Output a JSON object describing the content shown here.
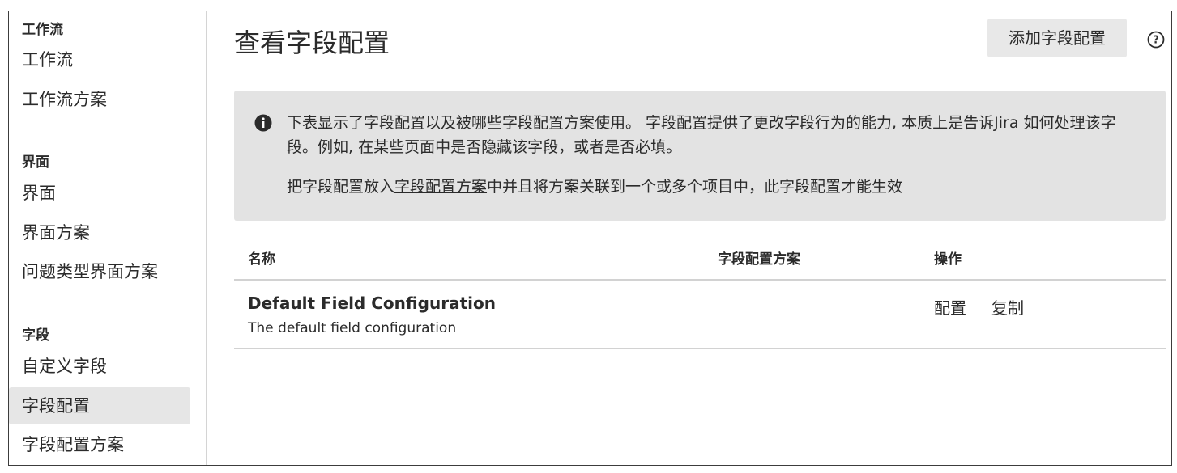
{
  "sidebar": {
    "sections": [
      {
        "heading": "工作流",
        "items": [
          "工作流",
          "工作流方案"
        ]
      },
      {
        "heading": "界面",
        "items": [
          "界面",
          "界面方案",
          "问题类型界面方案"
        ]
      },
      {
        "heading": "字段",
        "items": [
          "自定义字段",
          "字段配置",
          "字段配置方案"
        ]
      }
    ],
    "active_item": "字段配置"
  },
  "main": {
    "title": "查看字段配置",
    "add_button": "添加字段配置",
    "help_icon": "question-circle-icon",
    "info": {
      "icon": "info-circle-icon",
      "line1": "下表显示了字段配置以及被哪些字段配置方案使用。 字段配置提供了更改字段行为的能力, 本质上是告诉Jira 如何处理该字段。例如, 在某些页面中是否隐藏该字段，或者是否必填。",
      "line2_prefix": "把字段配置放入",
      "line2_link": "字段配置方案",
      "line2_suffix": "中并且将方案关联到一个或多个项目中，此字段配置才能生效"
    },
    "table": {
      "headers": [
        "名称",
        "字段配置方案",
        "操作"
      ],
      "rows": [
        {
          "name": "Default Field Configuration",
          "description": "The default field configuration",
          "schemes": "",
          "actions": [
            "配置",
            "复制"
          ]
        }
      ]
    }
  }
}
